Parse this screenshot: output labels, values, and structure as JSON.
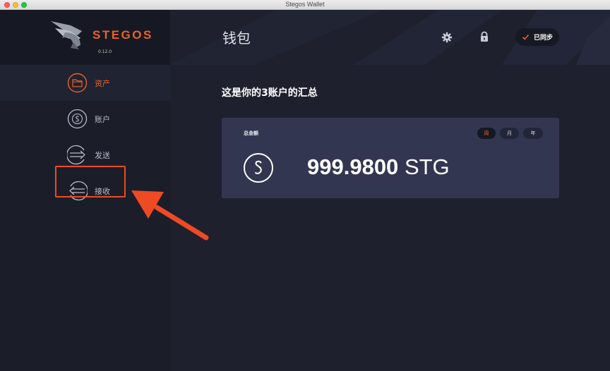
{
  "window": {
    "title": "Stegos Wallet"
  },
  "brand": {
    "name": "STEGOS",
    "version": "0.12.0"
  },
  "sidebar": {
    "items": [
      {
        "label": "资产",
        "icon": "folder-icon",
        "active": true
      },
      {
        "label": "账户",
        "icon": "stg-coin-icon",
        "active": false
      },
      {
        "label": "发送",
        "icon": "send-arrow-icon",
        "active": false
      },
      {
        "label": "接收",
        "icon": "receive-arrow-icon",
        "active": false,
        "highlighted": true
      }
    ]
  },
  "header": {
    "title": "钱包",
    "settings_icon": "gear-icon",
    "lock_icon": "lock-icon",
    "sync": {
      "label": "已同步",
      "icon": "check-icon"
    }
  },
  "main": {
    "summary_heading": "这是你的3账户的汇总",
    "card": {
      "label": "总金额",
      "periods": [
        {
          "label": "周",
          "active": true
        },
        {
          "label": "月",
          "active": false
        },
        {
          "label": "年",
          "active": false
        }
      ],
      "amount": "999.9800",
      "unit": "STG"
    }
  },
  "colors": {
    "accent": "#e9622c",
    "annotation": "#ee4a23",
    "background": "#1e212d",
    "sidebar": "#1b1e29",
    "card": "#333650"
  }
}
